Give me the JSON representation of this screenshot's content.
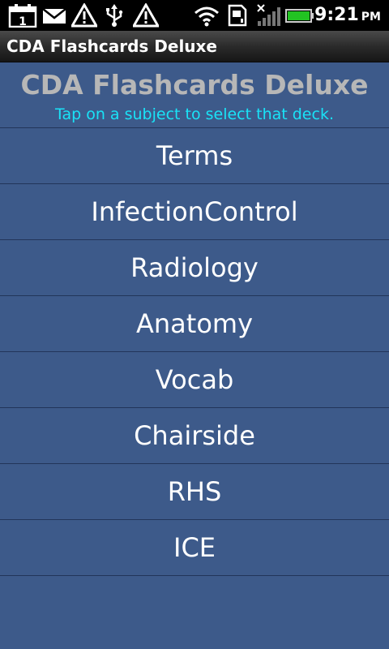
{
  "status_bar": {
    "time": "9:21",
    "ampm": "PM",
    "calendar_day": "1",
    "icons": [
      "calendar-icon",
      "mail-icon",
      "warning-icon",
      "usb-icon",
      "warning-icon",
      "wifi-icon",
      "sd-card-icon",
      "no-signal-icon",
      "battery-icon"
    ],
    "battery_level": 1.0
  },
  "title_bar": {
    "title": "CDA Flashcards Deluxe"
  },
  "header": {
    "heading": "CDA Flashcards Deluxe",
    "subtitle": "Tap on a subject to select that deck."
  },
  "decks": [
    {
      "label": "Terms"
    },
    {
      "label": "InfectionControl"
    },
    {
      "label": "Radiology"
    },
    {
      "label": "Anatomy"
    },
    {
      "label": "Vocab"
    },
    {
      "label": "Chairside"
    },
    {
      "label": "RHS"
    },
    {
      "label": "ICE"
    }
  ],
  "colors": {
    "background": "#3d5a8a",
    "heading": "#b7b7b7",
    "subtitle": "#19e3f7",
    "battery": "#22c322"
  }
}
